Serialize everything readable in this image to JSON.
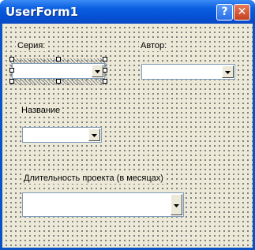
{
  "window": {
    "title": "UserForm1"
  },
  "titlebar_buttons": {
    "help": "?",
    "close": "✕"
  },
  "form": {
    "series_label": "Серия:",
    "series_value": "",
    "author_label": "Автор:",
    "author_value": "",
    "name_label": "Название",
    "name_value": "",
    "duration_label": "Длительность проекта (в месяцах)",
    "duration_value": ""
  }
}
